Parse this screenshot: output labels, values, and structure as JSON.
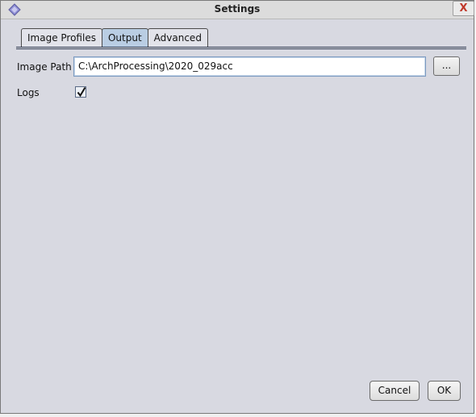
{
  "window": {
    "title": "Settings",
    "close_label": "X"
  },
  "tabs": [
    {
      "label": "Image Profiles",
      "active": false
    },
    {
      "label": "Output",
      "active": true
    },
    {
      "label": "Advanced",
      "active": false
    }
  ],
  "output": {
    "image_path_label": "Image Path",
    "image_path_value": "C:\\ArchProcessing\\2020_029acc",
    "browse_label": "...",
    "logs_label": "Logs",
    "logs_checked": true
  },
  "footer": {
    "cancel_label": "Cancel",
    "ok_label": "OK"
  },
  "colors": {
    "active_tab": "#b9cde3",
    "panel_bg": "#d8d9e1",
    "input_border": "#7b9ac0"
  }
}
